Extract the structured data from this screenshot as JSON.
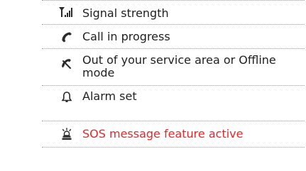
{
  "colors": {
    "text": "#1f1f1f",
    "alert_text": "#e8262a",
    "icon": "#2b2b2b",
    "divider": "#9a9a9a"
  },
  "rows": [
    {
      "icon": "signal-strength-icon",
      "description": "Signal strength"
    },
    {
      "icon": "call-in-progress-icon",
      "description": "Call in progress"
    },
    {
      "icon": "no-service-icon",
      "description": "Out of your service area or Offline mode"
    },
    {
      "icon": "alarm-bell-icon",
      "description": "Alarm set"
    },
    {
      "icon": "sos-message-icon",
      "description": "SOS message feature active"
    }
  ]
}
